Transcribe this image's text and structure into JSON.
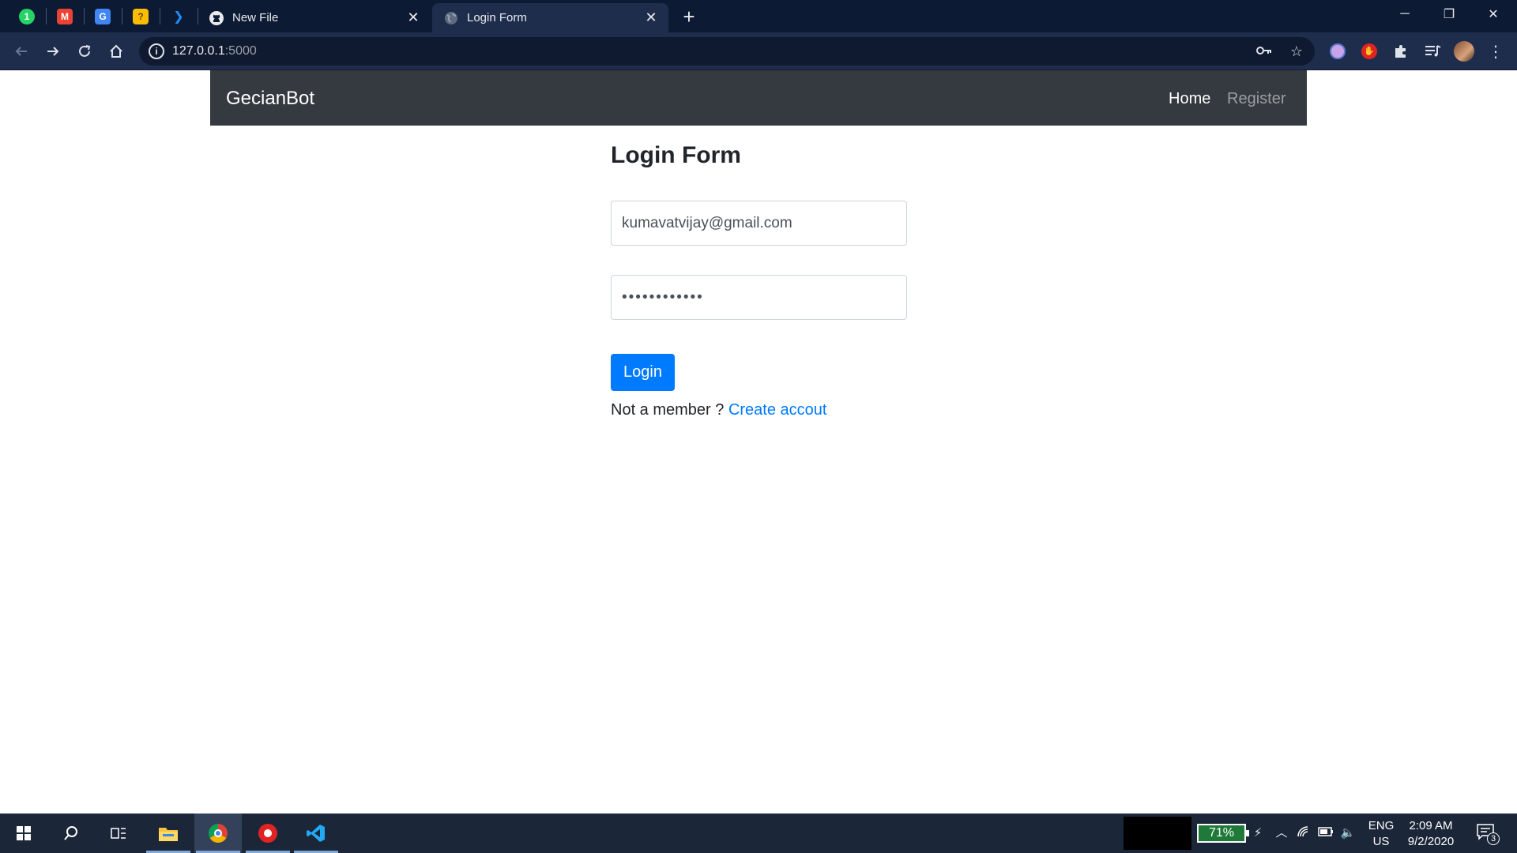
{
  "browser": {
    "pinned_tabs": [
      {
        "name": "whatsapp-icon",
        "glyph": "1",
        "color": "#25D366"
      },
      {
        "name": "gmail-icon",
        "glyph": "M",
        "color": "#EA4335"
      },
      {
        "name": "google-translate-icon",
        "glyph": "G",
        "color": "#4285F4"
      },
      {
        "name": "google-keep-icon",
        "glyph": "?",
        "color": "#FBBC04"
      },
      {
        "name": "power-automate-icon",
        "glyph": "❯",
        "color": "#0a66ff"
      }
    ],
    "tabs": [
      {
        "title": "New File",
        "favicon": "github-icon",
        "active": false
      },
      {
        "title": "Login Form",
        "favicon": "globe-icon",
        "active": true
      }
    ],
    "address": {
      "host": "127.0.0.1",
      "port": ":5000"
    }
  },
  "navbar": {
    "brand": "GecianBot",
    "links": [
      "Home",
      "Register"
    ]
  },
  "form": {
    "title": "Login Form",
    "email_value": "kumavatvijay@gmail.com",
    "password_value": "••••••••••••",
    "submit_label": "Login",
    "member_prompt": "Not a member ?",
    "create_link": "Create accout"
  },
  "taskbar": {
    "battery_percent": "71%",
    "language": "ENG",
    "region": "US",
    "time": "2:09 AM",
    "date": "9/2/2020",
    "notification_count": "3"
  },
  "colors": {
    "titlebar": "#0d1a33",
    "toolbar": "#1f2d4d",
    "navbar": "#343a40",
    "primary": "#007bff",
    "taskbar": "#1b2638"
  }
}
